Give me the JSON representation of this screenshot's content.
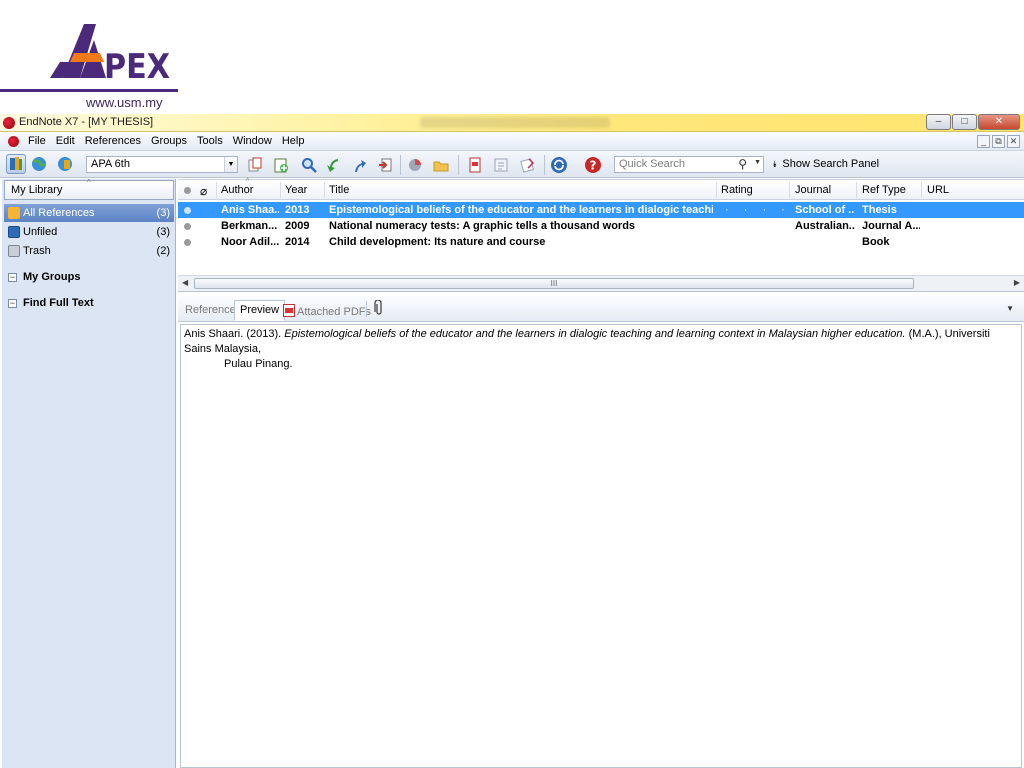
{
  "logo": {
    "brand_text": "APEX",
    "url_text": "www.usm.my"
  },
  "window": {
    "title": "EndNote X7 - [MY THESIS]",
    "buttons": {
      "minimize": "–",
      "maximize": "□",
      "close": "✕"
    }
  },
  "menu": {
    "items": [
      "File",
      "Edit",
      "References",
      "Groups",
      "Tools",
      "Window",
      "Help"
    ],
    "mdi_buttons": [
      "_",
      "⧉",
      "✕"
    ]
  },
  "toolbar": {
    "output_style": "APA 6th",
    "quick_search_placeholder": "Quick Search",
    "show_search_panel": "Show Search Panel",
    "icons": [
      "local-library-mode-icon",
      "online-search-mode-icon",
      "integrated-library-mode-icon",
      "copy-to-library-icon",
      "new-reference-icon",
      "online-search-icon",
      "import-icon",
      "export-icon",
      "insert-citation-icon",
      "format-bibliography-icon",
      "find-full-text-icon",
      "open-pdf-icon",
      "open-link-icon",
      "attach-file-icon",
      "sync-icon",
      "help-icon"
    ]
  },
  "library": {
    "header": "My Library",
    "groups": [
      {
        "label": "All References",
        "count": "(3)",
        "selected": true,
        "icon": "all-references-icon"
      },
      {
        "label": "Unfiled",
        "count": "(3)",
        "selected": false,
        "icon": "unfiled-icon"
      },
      {
        "label": "Trash",
        "count": "(2)",
        "selected": false,
        "icon": "trash-icon"
      }
    ],
    "sections": [
      {
        "label": "My Groups",
        "toggle": "⊟"
      },
      {
        "label": "Find Full Text",
        "toggle": "⊟"
      }
    ]
  },
  "reference_list": {
    "columns": [
      "Author",
      "Year",
      "Title",
      "Rating",
      "Journal",
      "Ref Type",
      "URL"
    ],
    "rows": [
      {
        "author": "Anis Shaa...",
        "year": "2013",
        "title": "Epistemological beliefs of the educator and the learners in dialogic teaching an...",
        "rating": "· · · · ·",
        "journal": "School of ...",
        "ref_type": "Thesis",
        "url": "",
        "selected": true
      },
      {
        "author": "Berkman...",
        "year": "2009",
        "title": "National numeracy tests: A graphic tells a thousand words",
        "rating": "",
        "journal": "Australian...",
        "ref_type": "Journal A...",
        "url": "",
        "selected": false
      },
      {
        "author": "Noor Adil...",
        "year": "2014",
        "title": "Child development: Its nature and course",
        "rating": "",
        "journal": "",
        "ref_type": "Book",
        "url": "",
        "selected": false
      }
    ],
    "scroll_thumb": "III"
  },
  "preview": {
    "tabs": [
      "Reference",
      "Preview",
      "Attached PDFs"
    ],
    "active_tab": "Preview",
    "citation": {
      "lead": "Anis Shaari. (2013). ",
      "title_italic": "Epistemological beliefs of the educator and the learners in dialogic teaching and learning context in Malaysian higher education.",
      "tail": " (M.A.), Universiti Sains Malaysia,",
      "line2": "Pulau Pinang."
    }
  },
  "colors": {
    "selection": "#3399ff",
    "group_selected": "#5c83c3",
    "title_bar": "#fff2a0",
    "logo_purple": "#4b2a7b",
    "logo_orange": "#f07a1a"
  }
}
